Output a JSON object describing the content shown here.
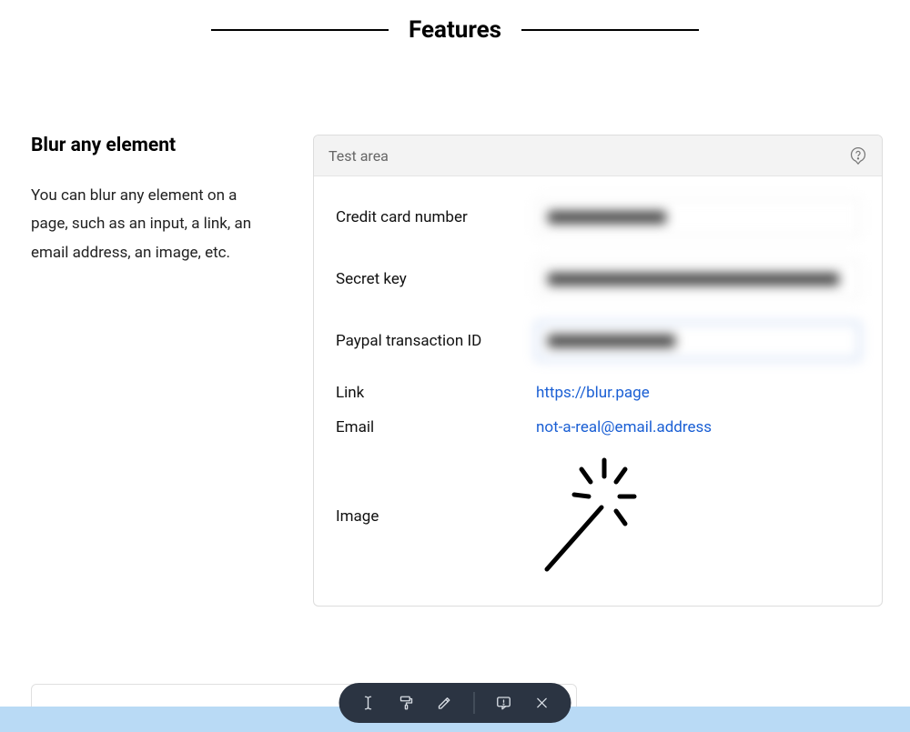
{
  "section_title": "Features",
  "feature": {
    "heading": "Blur any element",
    "description": "You can blur any element on a page, such as an input, a link, an email address, an image, etc."
  },
  "test_area": {
    "title": "Test area",
    "rows": {
      "credit_card_label": "Credit card number",
      "secret_key_label": "Secret key",
      "paypal_label": "Paypal transaction ID",
      "link_label": "Link",
      "link_value": "https://blur.page",
      "email_label": "Email",
      "email_value": "not-a-real@email.address",
      "image_label": "Image"
    }
  },
  "toolbar": {
    "tools": [
      "text-cursor",
      "paint-roller",
      "pen",
      "message",
      "close"
    ]
  }
}
